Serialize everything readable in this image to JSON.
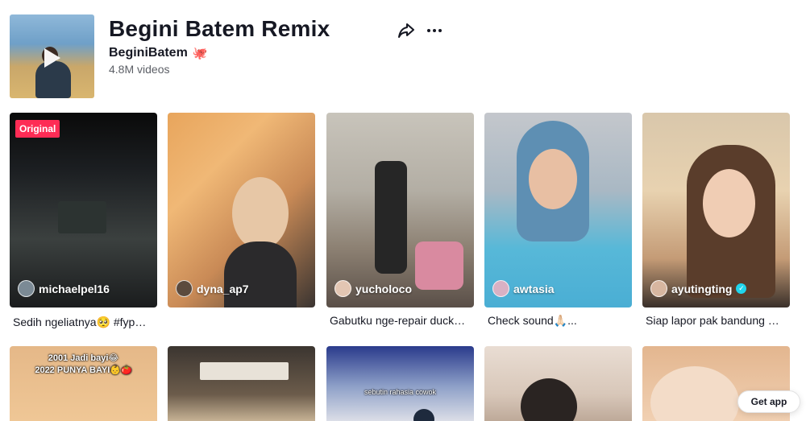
{
  "sound": {
    "title": "Begini Batem Remix",
    "artist": "BeginiBatem",
    "artist_emoji": "🐙",
    "video_count": "4.8M videos"
  },
  "header": {
    "share_icon": "share-icon",
    "more_icon": "more-icon"
  },
  "videos": [
    {
      "badge": "Original",
      "username": "michaelpel16",
      "caption": "Sedih ngeliatnya🥺 #fypシ ...",
      "verified": false
    },
    {
      "username": "dyna_ap7",
      "caption": "",
      "verified": false
    },
    {
      "username": "yucholoco",
      "caption": "Gabutku nge-repair duckta...",
      "verified": false
    },
    {
      "username": "awtasia",
      "caption": "Check sound🙏🏻...",
      "verified": false
    },
    {
      "username": "ayutingting",
      "caption": "Siap lapor pak bandung h...",
      "verified": true
    }
  ],
  "row2": [
    {
      "overlay": "2001 Jadi bayi😂\n2022 PUNYA BAYI👶🍅"
    },
    {
      "overlay": ""
    },
    {
      "overlay": "sebutin rahasia cowok"
    },
    {
      "overlay": ""
    },
    {
      "overlay": ""
    }
  ],
  "cta": {
    "get_app": "Get app"
  },
  "colors": {
    "accent": "#fe2c55",
    "verified": "#20d5ec",
    "text": "#161823",
    "muted": "#5c5f66"
  }
}
